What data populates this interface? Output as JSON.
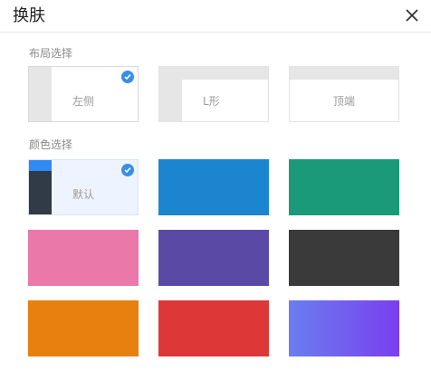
{
  "dialog": {
    "title": "换肤"
  },
  "layout_section": {
    "label": "布局选择",
    "options": [
      {
        "label": "左侧",
        "selected": true
      },
      {
        "label": "L形",
        "selected": false
      },
      {
        "label": "顶端",
        "selected": false
      }
    ]
  },
  "color_section": {
    "label": "颜色选择",
    "options": [
      {
        "label": "默认",
        "selected": true,
        "colors": [
          "#2f8af3",
          "#313b47",
          "#eef4ff"
        ]
      },
      {
        "label": "",
        "selected": false,
        "colors": [
          "#1b86cf"
        ]
      },
      {
        "label": "",
        "selected": false,
        "colors": [
          "#1a9a78"
        ]
      },
      {
        "label": "",
        "selected": false,
        "colors": [
          "#ea78a8"
        ]
      },
      {
        "label": "",
        "selected": false,
        "colors": [
          "#5a4aa6"
        ]
      },
      {
        "label": "",
        "selected": false,
        "colors": [
          "#3a3a3a"
        ]
      },
      {
        "label": "",
        "selected": false,
        "colors": [
          "#e8800f"
        ]
      },
      {
        "label": "",
        "selected": false,
        "colors": [
          "#de3737"
        ]
      },
      {
        "label": "",
        "selected": false,
        "colors": [
          "#6a7ef0",
          "#7a3ff0"
        ]
      }
    ]
  },
  "icons": {
    "close": "close-icon",
    "check": "checkmark-icon"
  }
}
